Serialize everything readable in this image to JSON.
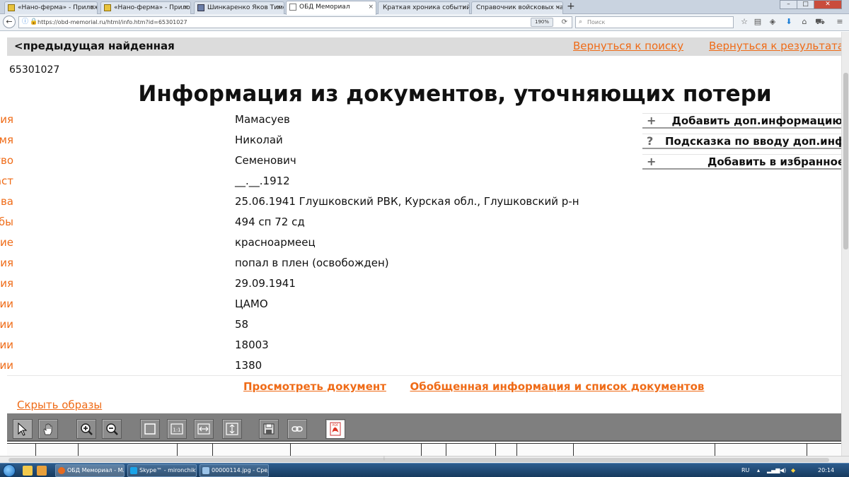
{
  "browser": {
    "tabs": [
      {
        "title": "«Нано-ферма» - Приложение"
      },
      {
        "title": "«Нано-ферма» - Приложение"
      },
      {
        "title": "Шинкаренко Яков Тимофеевич"
      },
      {
        "title": "ОБД Мемориал",
        "active": true
      },
      {
        "title": "Краткая хроника событий в Кал"
      },
      {
        "title": "Справочник войсковых частей"
      }
    ],
    "new_tab": "+",
    "url": "https://obd-memorial.ru/html/info.htm?id=65301027",
    "zoom": "190%",
    "search_placeholder": "Поиск"
  },
  "page": {
    "prev_found": "<предыдущая найденная",
    "back_to_search": "Вернуться к поиску",
    "back_to_results": "Вернуться к результатам",
    "record_id": "65301027",
    "title": "Информация из документов, уточняющих потери",
    "fields": [
      {
        "label": "Фамилия",
        "value": "Мамасуев"
      },
      {
        "label": "Имя",
        "value": "Николай"
      },
      {
        "label": "Отчество",
        "value": "Семенович"
      },
      {
        "label": "Дата рождения/Возраст",
        "value": "__.__.1912"
      },
      {
        "label": "Дата и место призыва",
        "value": "25.06.1941 Глушковский РВК, Курская обл., Глушковский р-н"
      },
      {
        "label": "Последнее место службы",
        "value": "494 сп 72 сд"
      },
      {
        "label": "Воинское звание",
        "value": "красноармеец"
      },
      {
        "label": "Причина выбытия",
        "value": "попал в плен (освобожден)"
      },
      {
        "label": "Дата выбытия",
        "value": "29.09.1941"
      },
      {
        "label": "Название источника информации",
        "value": "ЦАМО"
      },
      {
        "label": "Номер фонда источника информации",
        "value": "58"
      },
      {
        "label": "Номер описи источника информации",
        "value": "18003"
      },
      {
        "label": "Номер дела источника информации",
        "value": "1380"
      }
    ],
    "side_buttons": [
      {
        "symbol": "+",
        "label": "Добавить доп.информацию"
      },
      {
        "symbol": "?",
        "label": "Подсказка по вводу доп.информации"
      },
      {
        "symbol": "+",
        "label": "Добавить в избранное"
      }
    ],
    "view_document": "Просмотреть документ",
    "summary_info": "Обобщенная информация и список документов",
    "hide_images": "Скрыть образы"
  },
  "viewer_tools": [
    {
      "name": "pointer-tool-icon",
      "label": ""
    },
    {
      "name": "hand-tool-icon",
      "label": ""
    },
    {
      "name": "zoom-in-icon",
      "label": ""
    },
    {
      "name": "zoom-out-icon",
      "label": ""
    },
    {
      "name": "fit-page-icon",
      "label": ""
    },
    {
      "name": "actual-size-icon",
      "label": "1:1"
    },
    {
      "name": "fit-width-icon",
      "label": ""
    },
    {
      "name": "fit-height-icon",
      "label": ""
    },
    {
      "name": "save-icon",
      "label": ""
    },
    {
      "name": "link-icon",
      "label": ""
    },
    {
      "name": "pdf-icon",
      "label": "PDF"
    }
  ],
  "taskbar": {
    "tasks": [
      {
        "title": "ОБД Мемориал - M..."
      },
      {
        "title": "Skype™ - mironchikt..."
      },
      {
        "title": "00000114.jpg - Сред..."
      }
    ],
    "lang": "RU",
    "time": "20:14"
  },
  "colors": {
    "accent_orange": "#ef6b17",
    "toolbar_gray": "#7f7f7f",
    "topbar_gray": "#dcdcdc"
  }
}
